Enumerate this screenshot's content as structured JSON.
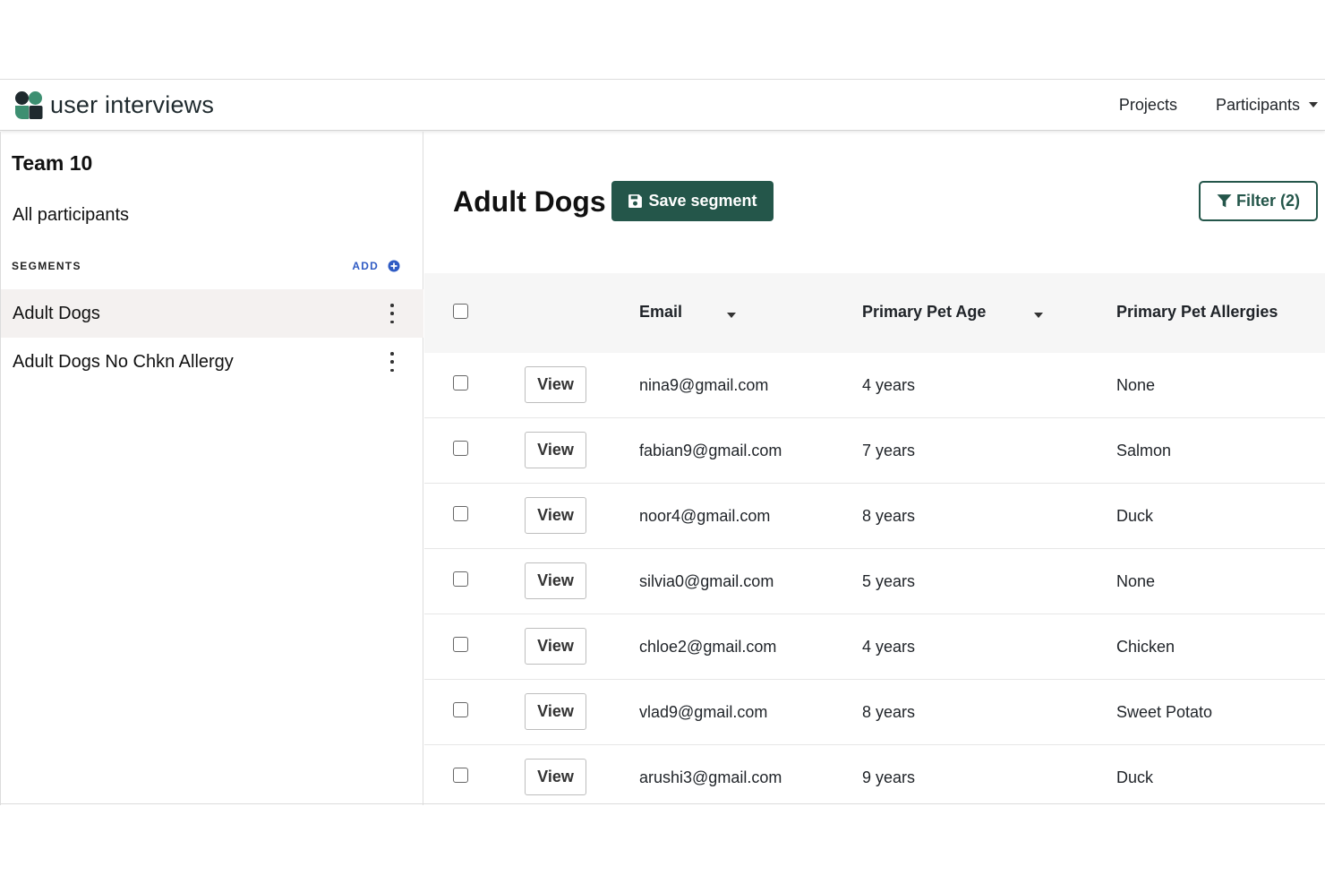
{
  "header": {
    "brand": "user interviews",
    "nav": [
      {
        "label": "Projects"
      },
      {
        "label": "Participants"
      }
    ]
  },
  "sidebar": {
    "team": "Team 10",
    "all_participants": "All participants",
    "segments_label": "SEGMENTS",
    "add_label": "ADD",
    "segments": [
      {
        "label": "Adult Dogs",
        "active": true
      },
      {
        "label": "Adult Dogs No Chkn Allergy",
        "active": false
      }
    ]
  },
  "main": {
    "title": "Adult Dogs",
    "save_label": "Save segment",
    "filter_label": "Filter (2)",
    "colors": {
      "accent": "#24564a",
      "link": "#2f5bc4"
    },
    "table": {
      "columns": [
        "Email",
        "Primary Pet Age",
        "Primary Pet Allergies"
      ],
      "view_label": "View",
      "rows": [
        {
          "email": "nina9@gmail.com",
          "age": "4 years",
          "allergy": "None"
        },
        {
          "email": "fabian9@gmail.com",
          "age": "7 years",
          "allergy": "Salmon"
        },
        {
          "email": "noor4@gmail.com",
          "age": "8 years",
          "allergy": "Duck"
        },
        {
          "email": "silvia0@gmail.com",
          "age": "5 years",
          "allergy": "None"
        },
        {
          "email": "chloe2@gmail.com",
          "age": "4 years",
          "allergy": "Chicken"
        },
        {
          "email": "vlad9@gmail.com",
          "age": "8 years",
          "allergy": "Sweet Potato"
        },
        {
          "email": "arushi3@gmail.com",
          "age": "9 years",
          "allergy": "Duck"
        }
      ]
    }
  }
}
